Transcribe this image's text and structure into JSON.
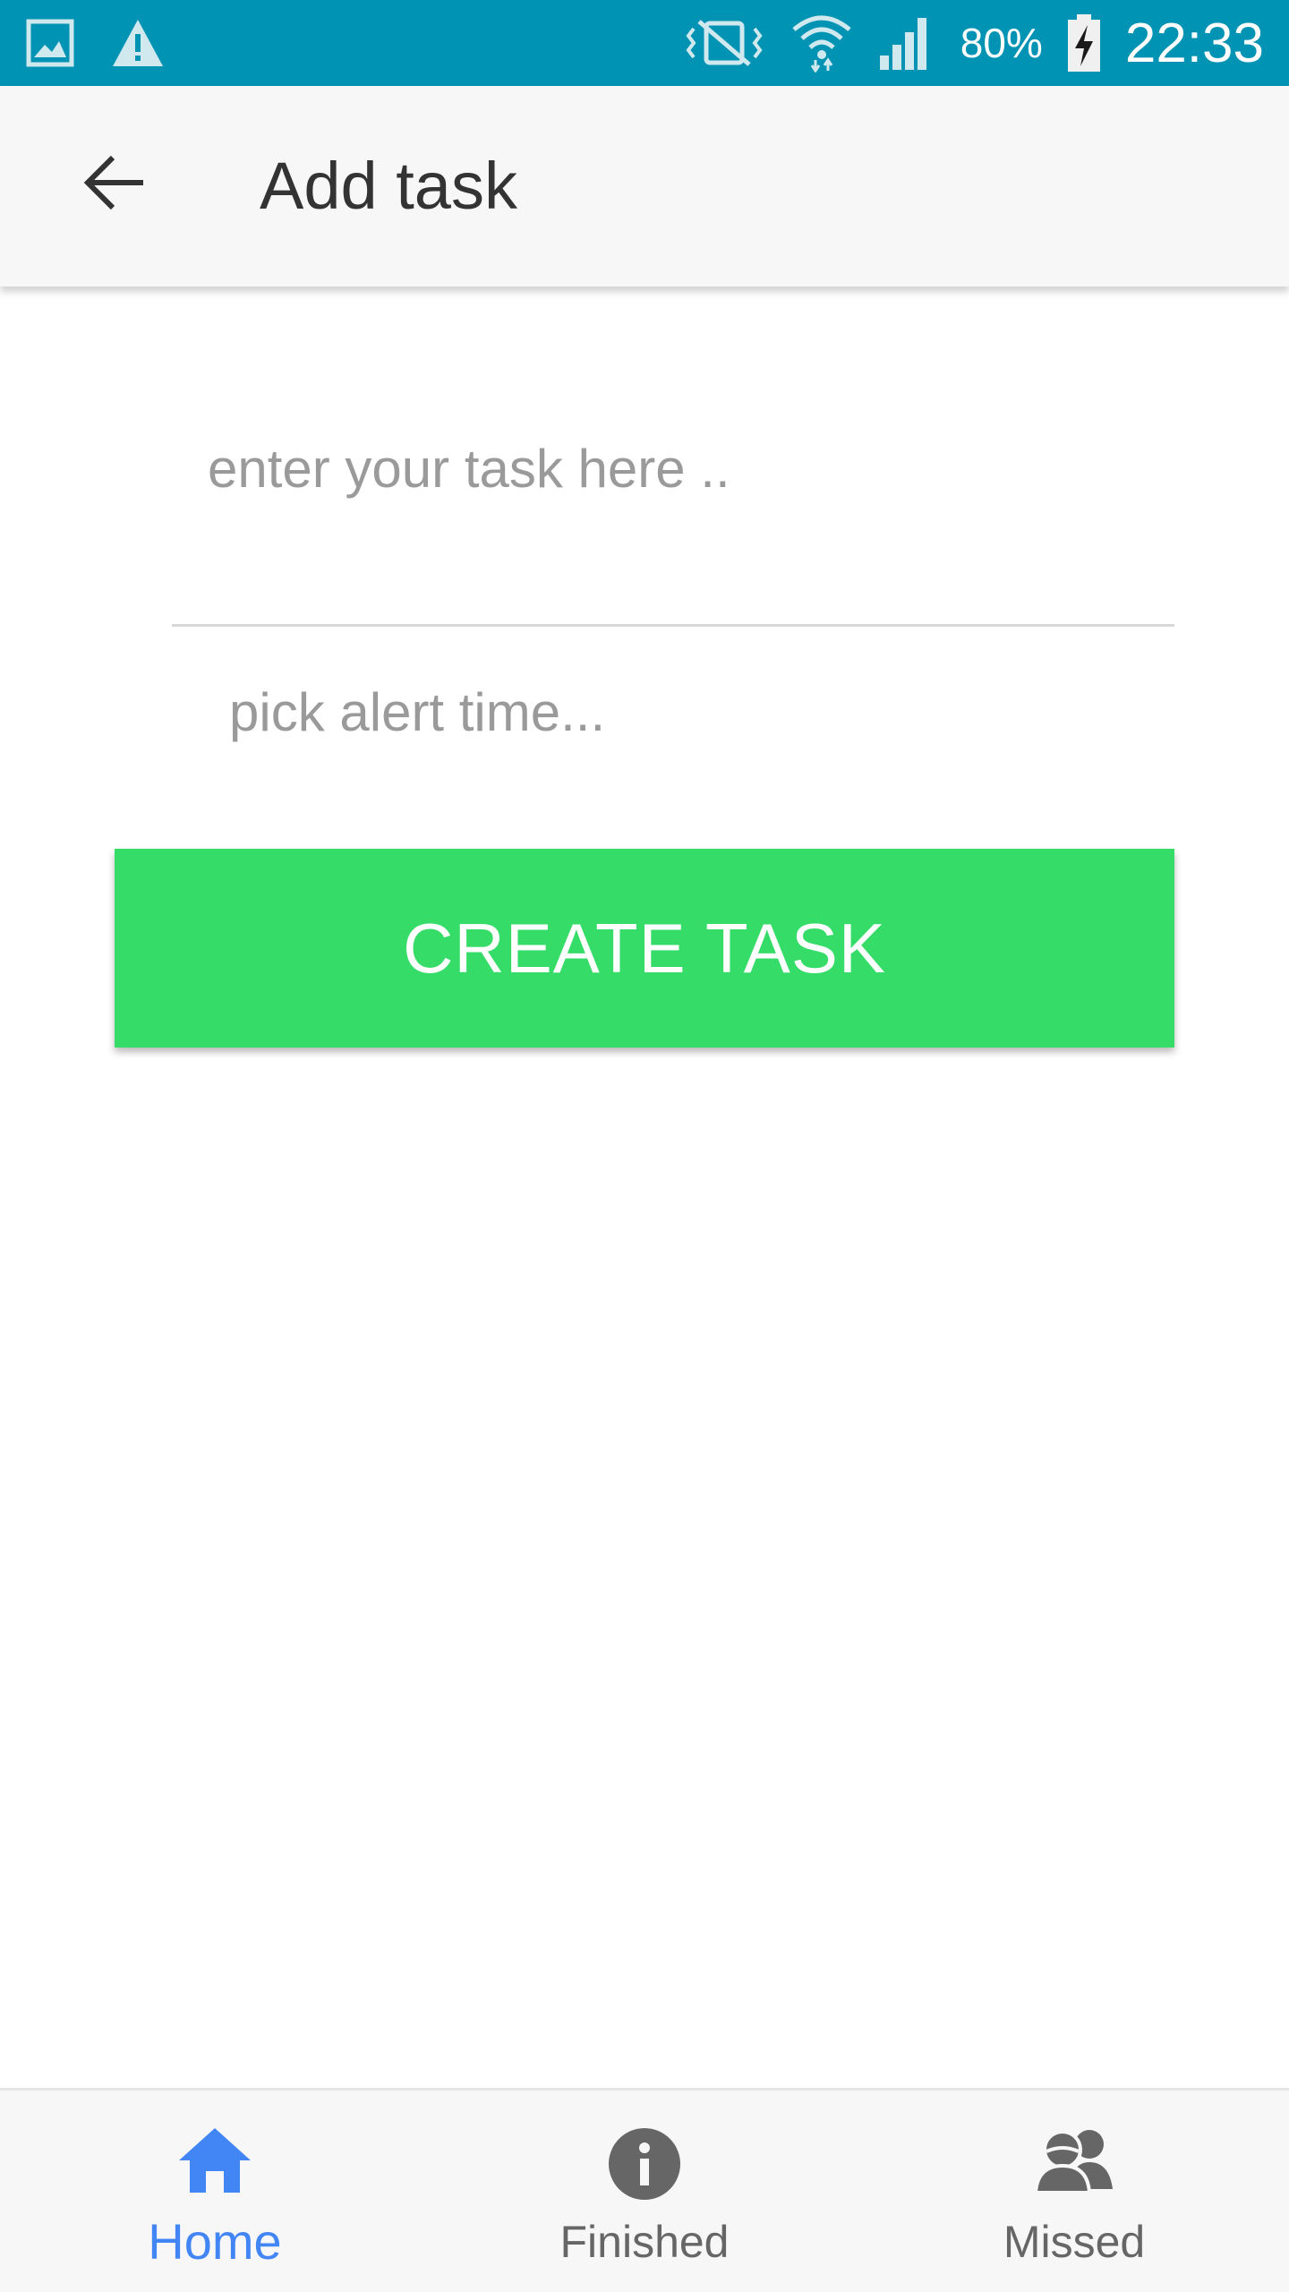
{
  "status_bar": {
    "battery_percent": "80%",
    "time": "22:33",
    "icons": [
      "gallery-icon",
      "warning-icon",
      "vibrate-icon",
      "wifi-icon",
      "signal-icon",
      "battery-charging-icon"
    ],
    "background_color": "#0193b3"
  },
  "app_bar": {
    "title": "Add task",
    "back_icon": "arrow-back-icon"
  },
  "form": {
    "task_placeholder": "enter your task here ..",
    "alert_time_placeholder": "pick alert time...",
    "create_button_label": "CREATE TASK",
    "create_button_color": "#35dd68"
  },
  "bottom_nav": {
    "items": [
      {
        "label": "Home",
        "icon": "home-icon",
        "active": true
      },
      {
        "label": "Finished",
        "icon": "info-icon",
        "active": false
      },
      {
        "label": "Missed",
        "icon": "people-icon",
        "active": false
      }
    ],
    "active_color": "#4285f4",
    "inactive_color": "#666666"
  }
}
